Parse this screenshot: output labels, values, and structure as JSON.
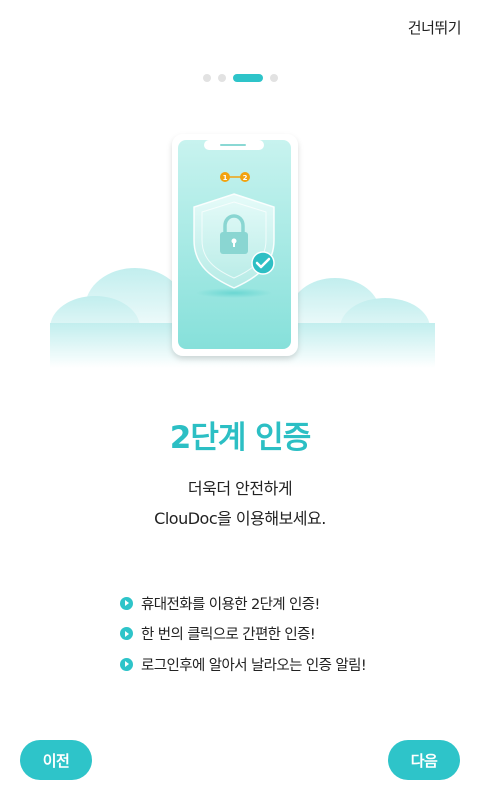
{
  "header": {
    "skip_label": "건너뛰기"
  },
  "pager": {
    "count": 4,
    "active_index": 2
  },
  "illustration": {
    "steps": [
      "1",
      "2"
    ]
  },
  "content": {
    "title": "2단계 인증",
    "desc_line1": "더욱더 안전하게",
    "desc_line2": "ClouDoc을 이용해보세요."
  },
  "features": [
    "휴대전화를 이용한 2단계 인증!",
    "한 번의 클릭으로 간편한 인증!",
    "로그인후에 알아서 날라오는 인증 알림!"
  ],
  "footer": {
    "prev_label": "이전",
    "next_label": "다음"
  },
  "colors": {
    "accent": "#2ec4c9",
    "title": "#2cbfc4",
    "step_badge": "#f2a20f"
  }
}
